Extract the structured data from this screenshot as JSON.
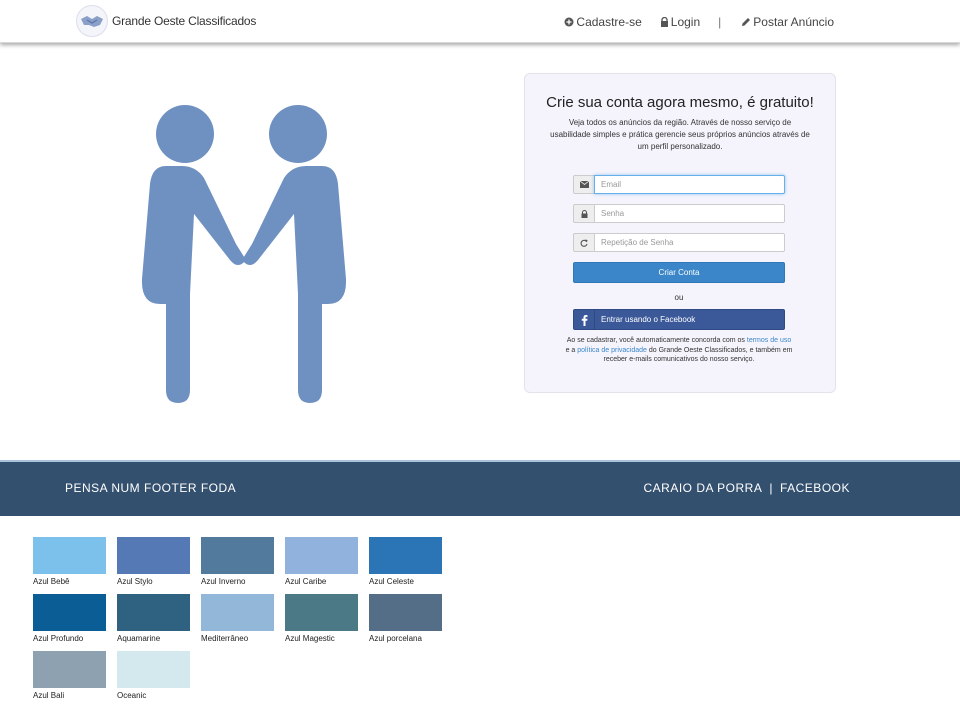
{
  "navbar": {
    "brand": "Grande Oeste Classificados",
    "links": [
      {
        "label": "Cadastre-se",
        "icon": "plus-circle-icon"
      },
      {
        "label": "Login",
        "icon": "lock-icon"
      },
      {
        "label": "Postar Anúncio",
        "icon": "pencil-icon"
      }
    ],
    "separator": "|"
  },
  "signup": {
    "title": "Crie sua conta agora mesmo, é gratuito!",
    "description": "Veja todos os anúncios da região. Através de nosso serviço de usabilidade simples e prática gerencie seus próprios anúncios através de um perfil personalizado.",
    "email_placeholder": "Email",
    "password_placeholder": "Senha",
    "password_repeat_placeholder": "Repetição de Senha",
    "create_button": "Criar Conta",
    "or": "ou",
    "facebook_button": "Entrar usando o Facebook",
    "terms_prefix": "Ao se cadastrar, você automaticamente concorda com os",
    "terms_link": "termos de uso",
    "terms_middle": "e a",
    "privacy_link": "política de privacidade",
    "terms_suffix": "do Grande Oeste Classificados, e também em receber e-mails comunicativos do nosso serviço."
  },
  "footer": {
    "left": "PENSA NUM FOOTER FODA",
    "right_1": "CARAIO DA PORRA",
    "separator": "|",
    "right_2": "FACEBOOK"
  },
  "colors": {
    "accent": "#3a86c8",
    "facebook": "#3b5998",
    "footer": "#34506f",
    "illustration": "#6f91c1"
  },
  "swatches": [
    {
      "name": "Azul Bebê",
      "color": "#7cc1eb"
    },
    {
      "name": "Azul Stylo",
      "color": "#5479b5"
    },
    {
      "name": "Azul Inverno",
      "color": "#527a9c"
    },
    {
      "name": "Azul Caribe",
      "color": "#91b2dc"
    },
    {
      "name": "Azul Celeste",
      "color": "#2b75b6"
    },
    {
      "name": "Azul Profundo",
      "color": "#0b5e95"
    },
    {
      "name": "Aquamarine",
      "color": "#2e6280"
    },
    {
      "name": "Mediterrâneo",
      "color": "#93b7d9"
    },
    {
      "name": "Azul Magestic",
      "color": "#4b7a86"
    },
    {
      "name": "Azul porcelana",
      "color": "#536e86"
    },
    {
      "name": "Azul Bali",
      "color": "#8ea1b0"
    },
    {
      "name": "Oceanic",
      "color": "#d3e9ee"
    }
  ]
}
